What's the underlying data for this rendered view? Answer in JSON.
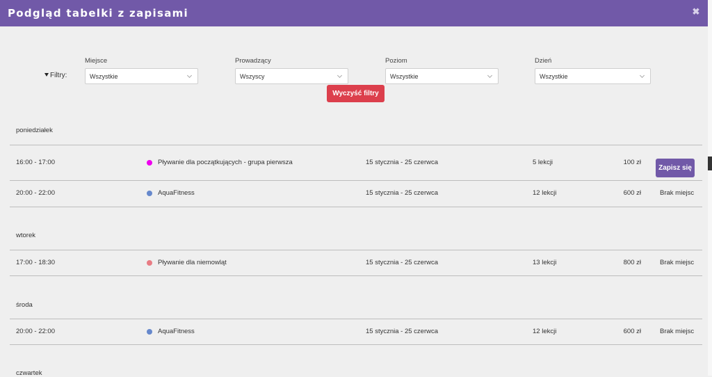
{
  "modal": {
    "title": "Podgląd tabelki z zapisami",
    "close_symbol": "✖"
  },
  "filters": {
    "label": "Filtry:",
    "groups": [
      {
        "label": "Miejsce",
        "value": "Wszystkie"
      },
      {
        "label": "Prowadzący",
        "value": "Wszyscy"
      },
      {
        "label": "Poziom",
        "value": "Wszystkie"
      },
      {
        "label": "Dzień",
        "value": "Wszystkie"
      }
    ],
    "clear_label": "Wyczyść filtry"
  },
  "days": [
    {
      "name": "poniedziałek",
      "entries": [
        {
          "time": "16:00 - 17:00",
          "name": "Pływanie dla początkujących - grupa pierwsza",
          "color": "#ee00ee",
          "dates": "15 stycznia - 25 czerwca",
          "lessons": "5 lekcji",
          "price": "100 zł",
          "action": "Zapisz się"
        },
        {
          "time": "20:00 - 22:00",
          "name": "AquaFitness",
          "color": "#6688cc",
          "dates": "15 stycznia - 25 czerwca",
          "lessons": "12 lekcji",
          "price": "600 zł",
          "action": "Brak miejsc"
        }
      ]
    },
    {
      "name": "wtorek",
      "entries": [
        {
          "time": "17:00 - 18:30",
          "name": "Pływanie dla niemowląt",
          "color": "#e87c84",
          "dates": "15 stycznia - 25 czerwca",
          "lessons": "13 lekcji",
          "price": "800 zł",
          "action": "Brak miejsc"
        }
      ]
    },
    {
      "name": "środa",
      "entries": [
        {
          "time": "20:00 - 22:00",
          "name": "AquaFitness",
          "color": "#6688cc",
          "dates": "15 stycznia - 25 czerwca",
          "lessons": "12 lekcji",
          "price": "600 zł",
          "action": "Brak miejsc"
        }
      ]
    },
    {
      "name": "czwartek",
      "entries": []
    }
  ]
}
